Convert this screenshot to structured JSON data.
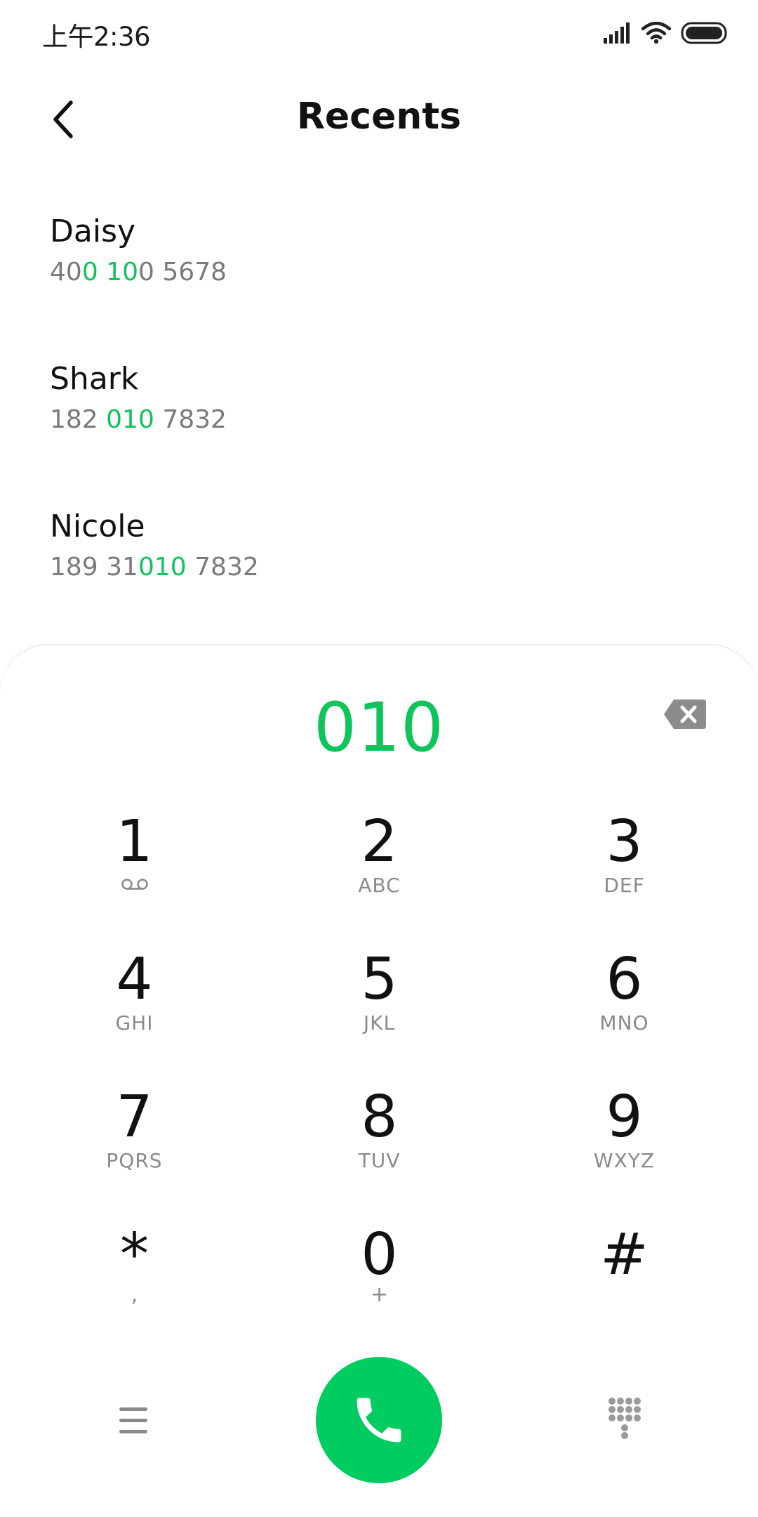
{
  "status_bar": {
    "time": "上午2:36",
    "icons": [
      "signal-icon",
      "wifi-icon",
      "battery-icon"
    ]
  },
  "header": {
    "title": "Recents",
    "back_icon": "chevron-left-icon"
  },
  "recents": [
    {
      "name": "Daisy",
      "number_parts": [
        {
          "text": "40",
          "highlight": false
        },
        {
          "text": "0 10",
          "highlight": true
        },
        {
          "text": "0 5678",
          "highlight": false
        }
      ]
    },
    {
      "name": "Shark",
      "number_parts": [
        {
          "text": "182 ",
          "highlight": false
        },
        {
          "text": "010",
          "highlight": true
        },
        {
          "text": " 7832",
          "highlight": false
        }
      ]
    },
    {
      "name": "Nicole",
      "number_parts": [
        {
          "text": "189 31",
          "highlight": false
        },
        {
          "text": "010",
          "highlight": true
        },
        {
          "text": " 7832",
          "highlight": false
        }
      ]
    }
  ],
  "dialer": {
    "input_value": "010",
    "backspace_icon": "backspace-icon",
    "keys": [
      {
        "digit": "1",
        "sub": "",
        "sub_icon": "voicemail-icon"
      },
      {
        "digit": "2",
        "sub": "ABC"
      },
      {
        "digit": "3",
        "sub": "DEF"
      },
      {
        "digit": "4",
        "sub": "GHI"
      },
      {
        "digit": "5",
        "sub": "JKL"
      },
      {
        "digit": "6",
        "sub": "MNO"
      },
      {
        "digit": "7",
        "sub": "PQRS"
      },
      {
        "digit": "8",
        "sub": "TUV"
      },
      {
        "digit": "9",
        "sub": "WXYZ"
      },
      {
        "digit": "*",
        "sub": ","
      },
      {
        "digit": "0",
        "sub": "+"
      },
      {
        "digit": "#",
        "sub": ""
      }
    ]
  },
  "bottom_bar": {
    "menu_icon": "menu-icon",
    "call_icon": "phone-icon",
    "dialpad_icon": "dialpad-icon"
  },
  "colors": {
    "accent": "#0ec45b",
    "call_button": "#00cc5f",
    "secondary_text": "#7a7a7a"
  }
}
